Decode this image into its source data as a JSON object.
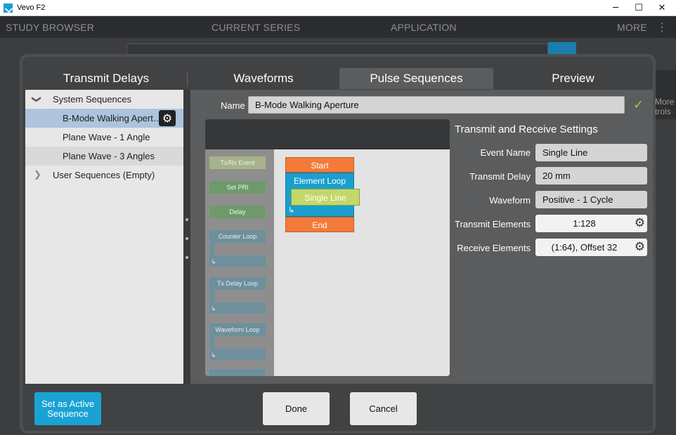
{
  "window": {
    "title": "Vevo F2",
    "minimize": "─",
    "maximize": "☐",
    "close": "✕"
  },
  "menubar": {
    "study_browser": "STUDY BROWSER",
    "current_series": "CURRENT SERIES",
    "application": "APPLICATION",
    "more": "MORE",
    "more_icon": "⋮"
  },
  "background": {
    "more_controls": "More\ntrols"
  },
  "tabs": [
    "Transmit Delays",
    "Waveforms",
    "Pulse Sequences",
    "Preview"
  ],
  "active_tab": "Pulse Sequences",
  "tree": {
    "system_sequences": "System Sequences",
    "items": [
      "B-Mode Walking Apert…",
      "Plane Wave - 1 Angle",
      "Plane Wave - 3 Angles"
    ],
    "user_sequences": "User Sequences (Empty)"
  },
  "name": {
    "label": "Name",
    "value": "B-Mode Walking Aperture"
  },
  "palette": {
    "txrx_event": "Tx/Rx Event",
    "set_pri": "Set PRI",
    "delay": "Delay",
    "counter_loop": "Counter Loop",
    "tx_delay_loop": "Tx Delay Loop",
    "waveform_loop": "Waveform Loop",
    "loop_icon": "↳"
  },
  "sequence": {
    "start": "Start",
    "element_loop": "Element Loop",
    "single_line": "Single Line",
    "end": "End",
    "loop_icon": "↳"
  },
  "settings": {
    "title": "Transmit and Receive Settings",
    "event_name_label": "Event Name",
    "event_name": "Single Line",
    "transmit_delay_label": "Transmit Delay",
    "transmit_delay": "20 mm",
    "waveform_label": "Waveform",
    "waveform": "Positive - 1 Cycle",
    "transmit_elements_label": "Transmit Elements",
    "transmit_elements": "1:128",
    "receive_elements_label": "Receive Elements",
    "receive_elements": "(1:64), Offset 32"
  },
  "buttons": {
    "set_active": "Set as Active Sequence",
    "done": "Done",
    "cancel": "Cancel"
  },
  "icons": {
    "gear": "⚙",
    "check": "✓",
    "chev_down": "❯",
    "chev_right": "❯"
  },
  "colors": {
    "start": "#f47a3a",
    "loop": "#1a9fcf",
    "event": "#c2d86a",
    "accent": "#1aa2d4",
    "selected": "#adc4dc"
  }
}
